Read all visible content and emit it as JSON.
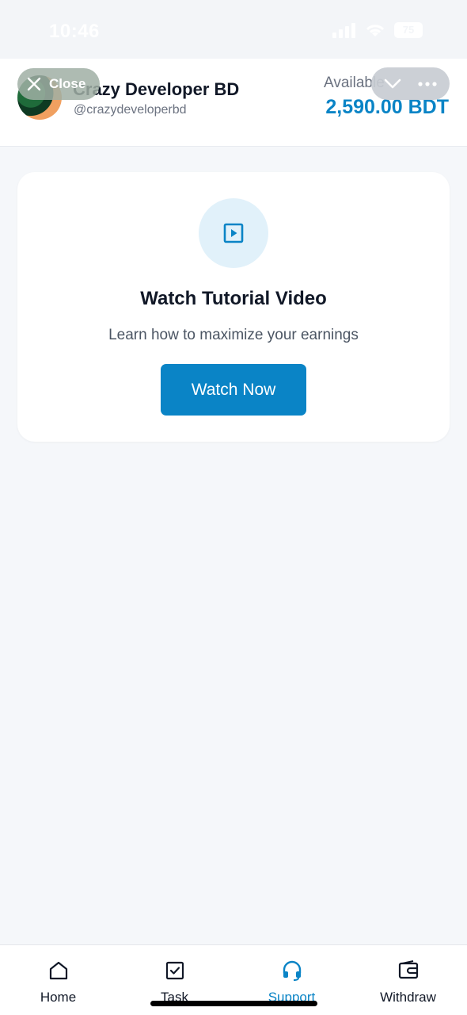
{
  "status_bar": {
    "time": "10:46",
    "battery": "75"
  },
  "header": {
    "user_name": "Crazy Developer BD",
    "user_handle": "@crazydeveloperbd",
    "balance_label": "Available",
    "balance_value": "2,590.00 BDT"
  },
  "overlay": {
    "close_label": "Close"
  },
  "card": {
    "icon": "play-icon",
    "title": "Watch Tutorial Video",
    "subtitle": "Learn how to maximize your earnings",
    "button_label": "Watch Now"
  },
  "nav": {
    "items": [
      {
        "label": "Home",
        "icon": "home-icon"
      },
      {
        "label": "Task",
        "icon": "task-check-icon"
      },
      {
        "label": "Support",
        "icon": "headset-icon",
        "active": true
      },
      {
        "label": "Withdraw",
        "icon": "wallet-icon"
      }
    ]
  },
  "colors": {
    "accent": "#0a84c6",
    "background": "#f5f7fa"
  }
}
